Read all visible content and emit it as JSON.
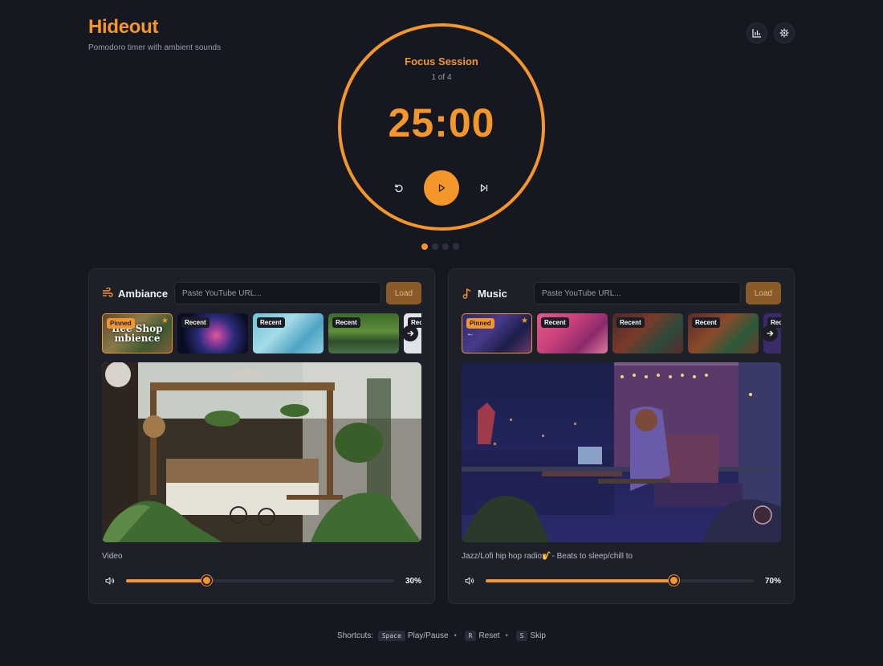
{
  "app": {
    "title": "Hideout",
    "subtitle": "Pomodoro timer with ambient sounds"
  },
  "toolbar": {
    "stats_icon": "bar-chart-icon",
    "settings_icon": "gear-icon"
  },
  "timer": {
    "session_label": "Focus Session",
    "session_count": "1 of 4",
    "time": "25:00",
    "accent": "#f5962a",
    "dots_total": 4,
    "dots_active": 1
  },
  "ambiance": {
    "title": "Ambiance",
    "icon": "wind-icon",
    "url_placeholder": "Paste YouTube URL...",
    "load_label": "Load",
    "thumbs": [
      {
        "badge": "Pinned",
        "text": "ffee Shop mbience"
      },
      {
        "badge": "Recent"
      },
      {
        "badge": "Recent"
      },
      {
        "badge": "Recent"
      },
      {
        "badge": "Rec"
      }
    ],
    "caption": "Video",
    "volume": 30,
    "volume_label": "30%"
  },
  "music": {
    "title": "Music",
    "icon": "music-note-icon",
    "url_placeholder": "Paste YouTube URL...",
    "load_label": "Load",
    "thumbs": [
      {
        "badge": "Pinned"
      },
      {
        "badge": "Recent"
      },
      {
        "badge": "Recent"
      },
      {
        "badge": "Recent"
      },
      {
        "badge": "Rec"
      }
    ],
    "caption": "Jazz/Lofi hip hop radio🎷- Beats to sleep/chill to",
    "volume": 70,
    "volume_label": "70%"
  },
  "shortcuts": {
    "label": "Shortcuts:",
    "items": [
      {
        "key": "Space",
        "action": "Play/Pause"
      },
      {
        "key": "R",
        "action": "Reset"
      },
      {
        "key": "S",
        "action": "Skip"
      }
    ]
  }
}
